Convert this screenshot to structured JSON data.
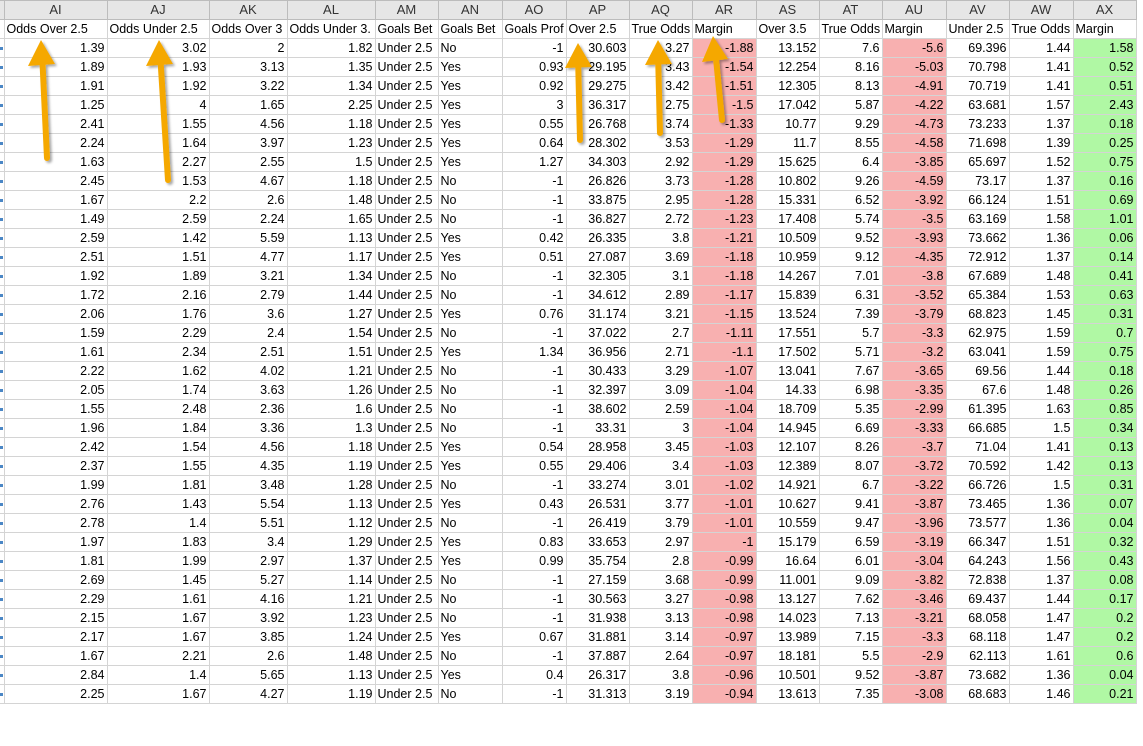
{
  "columns": [
    "AI",
    "AJ",
    "AK",
    "AL",
    "AM",
    "AN",
    "AO",
    "AP",
    "AQ",
    "AR",
    "AS",
    "AT",
    "AU",
    "AV",
    "AW",
    "AX"
  ],
  "headers": [
    "Odds Over 2.5",
    "Odds Under 2.5",
    "Odds Over 3",
    "Odds Under 3.",
    "Goals Bet",
    "Goals Bet",
    "Goals Prof",
    "Over 2.5",
    "True Odds",
    "Margin",
    "Over 3.5",
    "True Odds",
    "Margin",
    "Under 2.5",
    "True Odds",
    "Margin"
  ],
  "rows": [
    [
      "1.39",
      "3.02",
      "2",
      "1.82",
      "Under 2.5",
      "No",
      "-1",
      "30.603",
      "3.27",
      "-1.88",
      "13.152",
      "7.6",
      "-5.6",
      "69.396",
      "1.44",
      "1.58"
    ],
    [
      "1.89",
      "1.93",
      "3.13",
      "1.35",
      "Under 2.5",
      "Yes",
      "0.93",
      "29.195",
      "3.43",
      "-1.54",
      "12.254",
      "8.16",
      "-5.03",
      "70.798",
      "1.41",
      "0.52"
    ],
    [
      "1.91",
      "1.92",
      "3.22",
      "1.34",
      "Under 2.5",
      "Yes",
      "0.92",
      "29.275",
      "3.42",
      "-1.51",
      "12.305",
      "8.13",
      "-4.91",
      "70.719",
      "1.41",
      "0.51"
    ],
    [
      "1.25",
      "4",
      "1.65",
      "2.25",
      "Under 2.5",
      "Yes",
      "3",
      "36.317",
      "2.75",
      "-1.5",
      "17.042",
      "5.87",
      "-4.22",
      "63.681",
      "1.57",
      "2.43"
    ],
    [
      "2.41",
      "1.55",
      "4.56",
      "1.18",
      "Under 2.5",
      "Yes",
      "0.55",
      "26.768",
      "3.74",
      "-1.33",
      "10.77",
      "9.29",
      "-4.73",
      "73.233",
      "1.37",
      "0.18"
    ],
    [
      "2.24",
      "1.64",
      "3.97",
      "1.23",
      "Under 2.5",
      "Yes",
      "0.64",
      "28.302",
      "3.53",
      "-1.29",
      "11.7",
      "8.55",
      "-4.58",
      "71.698",
      "1.39",
      "0.25"
    ],
    [
      "1.63",
      "2.27",
      "2.55",
      "1.5",
      "Under 2.5",
      "Yes",
      "1.27",
      "34.303",
      "2.92",
      "-1.29",
      "15.625",
      "6.4",
      "-3.85",
      "65.697",
      "1.52",
      "0.75"
    ],
    [
      "2.45",
      "1.53",
      "4.67",
      "1.18",
      "Under 2.5",
      "No",
      "-1",
      "26.826",
      "3.73",
      "-1.28",
      "10.802",
      "9.26",
      "-4.59",
      "73.17",
      "1.37",
      "0.16"
    ],
    [
      "1.67",
      "2.2",
      "2.6",
      "1.48",
      "Under 2.5",
      "No",
      "-1",
      "33.875",
      "2.95",
      "-1.28",
      "15.331",
      "6.52",
      "-3.92",
      "66.124",
      "1.51",
      "0.69"
    ],
    [
      "1.49",
      "2.59",
      "2.24",
      "1.65",
      "Under 2.5",
      "No",
      "-1",
      "36.827",
      "2.72",
      "-1.23",
      "17.408",
      "5.74",
      "-3.5",
      "63.169",
      "1.58",
      "1.01"
    ],
    [
      "2.59",
      "1.42",
      "5.59",
      "1.13",
      "Under 2.5",
      "Yes",
      "0.42",
      "26.335",
      "3.8",
      "-1.21",
      "10.509",
      "9.52",
      "-3.93",
      "73.662",
      "1.36",
      "0.06"
    ],
    [
      "2.51",
      "1.51",
      "4.77",
      "1.17",
      "Under 2.5",
      "Yes",
      "0.51",
      "27.087",
      "3.69",
      "-1.18",
      "10.959",
      "9.12",
      "-4.35",
      "72.912",
      "1.37",
      "0.14"
    ],
    [
      "1.92",
      "1.89",
      "3.21",
      "1.34",
      "Under 2.5",
      "No",
      "-1",
      "32.305",
      "3.1",
      "-1.18",
      "14.267",
      "7.01",
      "-3.8",
      "67.689",
      "1.48",
      "0.41"
    ],
    [
      "1.72",
      "2.16",
      "2.79",
      "1.44",
      "Under 2.5",
      "No",
      "-1",
      "34.612",
      "2.89",
      "-1.17",
      "15.839",
      "6.31",
      "-3.52",
      "65.384",
      "1.53",
      "0.63"
    ],
    [
      "2.06",
      "1.76",
      "3.6",
      "1.27",
      "Under 2.5",
      "Yes",
      "0.76",
      "31.174",
      "3.21",
      "-1.15",
      "13.524",
      "7.39",
      "-3.79",
      "68.823",
      "1.45",
      "0.31"
    ],
    [
      "1.59",
      "2.29",
      "2.4",
      "1.54",
      "Under 2.5",
      "No",
      "-1",
      "37.022",
      "2.7",
      "-1.11",
      "17.551",
      "5.7",
      "-3.3",
      "62.975",
      "1.59",
      "0.7"
    ],
    [
      "1.61",
      "2.34",
      "2.51",
      "1.51",
      "Under 2.5",
      "Yes",
      "1.34",
      "36.956",
      "2.71",
      "-1.1",
      "17.502",
      "5.71",
      "-3.2",
      "63.041",
      "1.59",
      "0.75"
    ],
    [
      "2.22",
      "1.62",
      "4.02",
      "1.21",
      "Under 2.5",
      "No",
      "-1",
      "30.433",
      "3.29",
      "-1.07",
      "13.041",
      "7.67",
      "-3.65",
      "69.56",
      "1.44",
      "0.18"
    ],
    [
      "2.05",
      "1.74",
      "3.63",
      "1.26",
      "Under 2.5",
      "No",
      "-1",
      "32.397",
      "3.09",
      "-1.04",
      "14.33",
      "6.98",
      "-3.35",
      "67.6",
      "1.48",
      "0.26"
    ],
    [
      "1.55",
      "2.48",
      "2.36",
      "1.6",
      "Under 2.5",
      "No",
      "-1",
      "38.602",
      "2.59",
      "-1.04",
      "18.709",
      "5.35",
      "-2.99",
      "61.395",
      "1.63",
      "0.85"
    ],
    [
      "1.96",
      "1.84",
      "3.36",
      "1.3",
      "Under 2.5",
      "No",
      "-1",
      "33.31",
      "3",
      "-1.04",
      "14.945",
      "6.69",
      "-3.33",
      "66.685",
      "1.5",
      "0.34"
    ],
    [
      "2.42",
      "1.54",
      "4.56",
      "1.18",
      "Under 2.5",
      "Yes",
      "0.54",
      "28.958",
      "3.45",
      "-1.03",
      "12.107",
      "8.26",
      "-3.7",
      "71.04",
      "1.41",
      "0.13"
    ],
    [
      "2.37",
      "1.55",
      "4.35",
      "1.19",
      "Under 2.5",
      "Yes",
      "0.55",
      "29.406",
      "3.4",
      "-1.03",
      "12.389",
      "8.07",
      "-3.72",
      "70.592",
      "1.42",
      "0.13"
    ],
    [
      "1.99",
      "1.81",
      "3.48",
      "1.28",
      "Under 2.5",
      "No",
      "-1",
      "33.274",
      "3.01",
      "-1.02",
      "14.921",
      "6.7",
      "-3.22",
      "66.726",
      "1.5",
      "0.31"
    ],
    [
      "2.76",
      "1.43",
      "5.54",
      "1.13",
      "Under 2.5",
      "Yes",
      "0.43",
      "26.531",
      "3.77",
      "-1.01",
      "10.627",
      "9.41",
      "-3.87",
      "73.465",
      "1.36",
      "0.07"
    ],
    [
      "2.78",
      "1.4",
      "5.51",
      "1.12",
      "Under 2.5",
      "No",
      "-1",
      "26.419",
      "3.79",
      "-1.01",
      "10.559",
      "9.47",
      "-3.96",
      "73.577",
      "1.36",
      "0.04"
    ],
    [
      "1.97",
      "1.83",
      "3.4",
      "1.29",
      "Under 2.5",
      "Yes",
      "0.83",
      "33.653",
      "2.97",
      "-1",
      "15.179",
      "6.59",
      "-3.19",
      "66.347",
      "1.51",
      "0.32"
    ],
    [
      "1.81",
      "1.99",
      "2.97",
      "1.37",
      "Under 2.5",
      "Yes",
      "0.99",
      "35.754",
      "2.8",
      "-0.99",
      "16.64",
      "6.01",
      "-3.04",
      "64.243",
      "1.56",
      "0.43"
    ],
    [
      "2.69",
      "1.45",
      "5.27",
      "1.14",
      "Under 2.5",
      "No",
      "-1",
      "27.159",
      "3.68",
      "-0.99",
      "11.001",
      "9.09",
      "-3.82",
      "72.838",
      "1.37",
      "0.08"
    ],
    [
      "2.29",
      "1.61",
      "4.16",
      "1.21",
      "Under 2.5",
      "No",
      "-1",
      "30.563",
      "3.27",
      "-0.98",
      "13.127",
      "7.62",
      "-3.46",
      "69.437",
      "1.44",
      "0.17"
    ],
    [
      "2.15",
      "1.67",
      "3.92",
      "1.23",
      "Under 2.5",
      "No",
      "-1",
      "31.938",
      "3.13",
      "-0.98",
      "14.023",
      "7.13",
      "-3.21",
      "68.058",
      "1.47",
      "0.2"
    ],
    [
      "2.17",
      "1.67",
      "3.85",
      "1.24",
      "Under 2.5",
      "Yes",
      "0.67",
      "31.881",
      "3.14",
      "-0.97",
      "13.989",
      "7.15",
      "-3.3",
      "68.118",
      "1.47",
      "0.2"
    ],
    [
      "1.67",
      "2.21",
      "2.6",
      "1.48",
      "Under 2.5",
      "No",
      "-1",
      "37.887",
      "2.64",
      "-0.97",
      "18.181",
      "5.5",
      "-2.9",
      "62.113",
      "1.61",
      "0.6"
    ],
    [
      "2.84",
      "1.4",
      "5.65",
      "1.13",
      "Under 2.5",
      "Yes",
      "0.4",
      "26.317",
      "3.8",
      "-0.96",
      "10.501",
      "9.52",
      "-3.87",
      "73.682",
      "1.36",
      "0.04"
    ],
    [
      "2.25",
      "1.67",
      "4.27",
      "1.19",
      "Under 2.5",
      "No",
      "-1",
      "31.313",
      "3.19",
      "-0.94",
      "13.613",
      "7.35",
      "-3.08",
      "68.683",
      "1.46",
      "0.21"
    ]
  ],
  "colors": {
    "margin_red": "#f8b0b0",
    "margin_green": "#b0f8a4",
    "arrow": "#f5a800",
    "column_header_bg": "#e6e6e6"
  },
  "annotations": [
    "arrow-icon",
    "arrow-icon",
    "arrow-icon",
    "arrow-icon",
    "arrow-icon"
  ]
}
